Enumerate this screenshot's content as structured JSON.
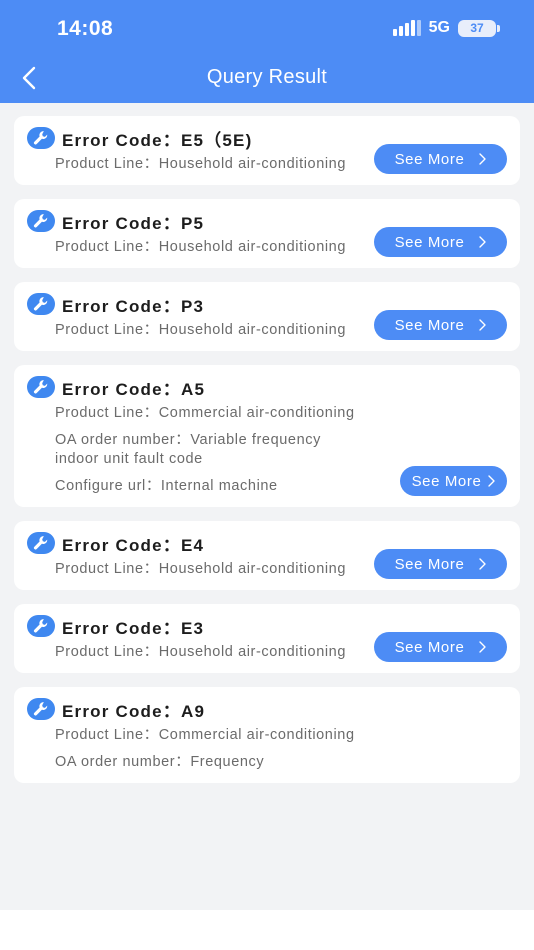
{
  "status": {
    "time": "14:08",
    "network": "5G",
    "battery": "37"
  },
  "header": {
    "title": "Query Result"
  },
  "results": [
    {
      "code": "Error Code：E5（5E)",
      "lines": [
        "Product Line：Household air-conditioning"
      ],
      "button": "See More"
    },
    {
      "code": "Error Code：P5",
      "lines": [
        "Product Line：Household air-conditioning"
      ],
      "button": "See More"
    },
    {
      "code": "Error Code：P3",
      "lines": [
        "Product Line：Household air-conditioning"
      ],
      "button": "See More"
    },
    {
      "code": "Error Code：A5",
      "lines": [
        "Product Line：Commercial air-conditioning",
        "OA order number：Variable frequency indoor unit fault code",
        "Configure url：Internal machine"
      ],
      "button": "See More"
    },
    {
      "code": "Error Code：E4",
      "lines": [
        "Product Line：Household air-conditioning"
      ],
      "button": "See More"
    },
    {
      "code": "Error Code：E3",
      "lines": [
        "Product Line：Household air-conditioning"
      ],
      "button": "See More"
    },
    {
      "code": "Error Code：A9",
      "lines": [
        "Product Line：Commercial air-conditioning",
        "OA order number：Frequency"
      ],
      "button": ""
    }
  ],
  "icons": {
    "back": "chevron-left-icon",
    "error": "wrench-icon",
    "more": "chevron-right-icon"
  },
  "colors": {
    "accent": "#4d8cf5",
    "background": "#f2f3f5"
  }
}
